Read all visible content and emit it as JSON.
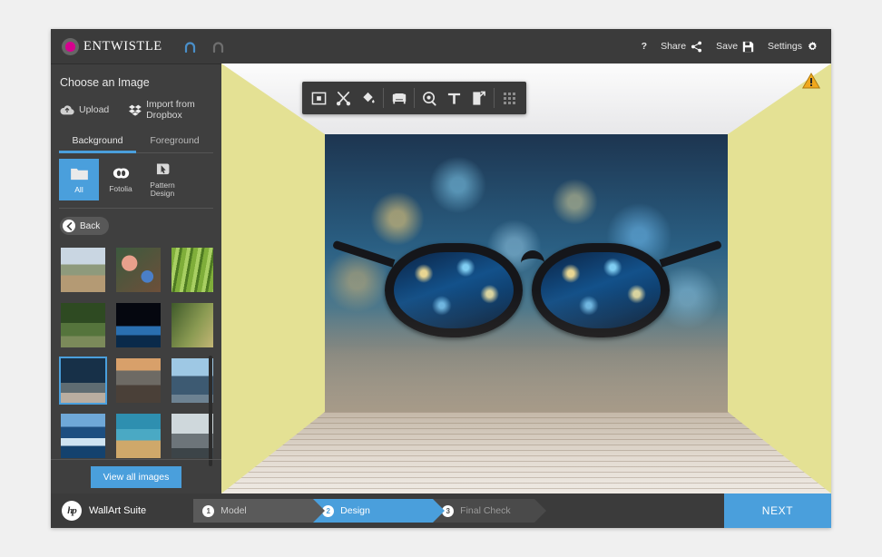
{
  "app": {
    "brand": "ENTWISTLE",
    "logo_color": "#d6008f",
    "accent_color": "#4a9fdc",
    "wall_color": "#e4e194"
  },
  "header": {
    "undo_label": "Undo",
    "redo_label": "Redo",
    "help_label": "?",
    "share_label": "Share",
    "save_label": "Save",
    "settings_label": "Settings"
  },
  "sidebar": {
    "title": "Choose an Image",
    "sources": [
      {
        "label": "Upload",
        "icon": "upload-icon"
      },
      {
        "label": "Import from Dropbox",
        "icon": "dropbox-icon"
      }
    ],
    "tabs": [
      {
        "label": "Background",
        "active": true
      },
      {
        "label": "Foreground",
        "active": false
      }
    ],
    "categories": [
      {
        "label": "All",
        "icon": "folder-icon",
        "active": true
      },
      {
        "label": "Fotolia",
        "icon": "fotolia-icon",
        "active": false
      },
      {
        "label": "Pattern Design",
        "icon": "cursor-icon",
        "active": false
      }
    ],
    "back_label": "Back",
    "view_all_label": "View all images",
    "thumbnails": [
      {
        "name": "cityscape-rooftops",
        "selected": false,
        "css": "linear-gradient(#c9d6e2 0 38%, #8e9a7c 38% 62%, #b49a74 62% 100%)"
      },
      {
        "name": "coral-reef-flowers",
        "selected": false,
        "css": "radial-gradient(circle at 30% 35%, #e8a08c 0 18%, transparent 19%), radial-gradient(circle at 70% 65%, #4a7fc8 0 14%, transparent 15%), linear-gradient(140deg,#3c5a3e,#6d4f3a)"
      },
      {
        "name": "bamboo-stalks",
        "selected": false,
        "css": "repeating-linear-gradient(100deg, #7fae3a 0 5px, #a8cf62 5px 9px, #4e7a22 9px 12px)"
      },
      {
        "name": "forest-path",
        "selected": false,
        "css": "linear-gradient(#2e4a22 0 45%, #55743c 45% 75%, #7b8a5a 75% 100%)"
      },
      {
        "name": "earth-from-space",
        "selected": false,
        "css": "linear-gradient(#05070f 0 52%, #2a6fb0 52% 72%, #0a2a4a 72% 100%)"
      },
      {
        "name": "green-tunnel-road",
        "selected": false,
        "css": "linear-gradient(120deg,#3f5a2a,#8a9a52 55%,#c8b878)"
      },
      {
        "name": "glasses-city-night",
        "selected": true,
        "css": "linear-gradient(#173048 0 55%, #5f6c72 55% 78%, #b9ada0 78% 100%)"
      },
      {
        "name": "rocky-coast-sunset",
        "selected": false,
        "css": "linear-gradient(#d8a06a 0 28%, #6d6a64 28% 60%, #4a4038 60% 100%)"
      },
      {
        "name": "skyscrapers-blue",
        "selected": false,
        "css": "linear-gradient(#9ec8e4 0 40%, #3d5a72 40% 82%, #6d8292 82% 100%)"
      },
      {
        "name": "iceberg-ocean",
        "selected": false,
        "css": "linear-gradient(#6fa8d8 0 30%, #1d4e80 30% 55%, #cfe4f2 55% 72%, #14426e 72% 100%)"
      },
      {
        "name": "sea-turtle-reef",
        "selected": false,
        "css": "linear-gradient(#2e8fb0 0 35%, #4aa9c4 35% 60%, #cfa86a 60% 100%)"
      },
      {
        "name": "viewing-binoculars",
        "selected": false,
        "css": "linear-gradient(#cfd8dc 0 45%, #6d757a 45% 78%, #3c4448 78% 100%)"
      }
    ]
  },
  "toolbar": {
    "tools": [
      {
        "name": "crop-tool",
        "icon": "crop-icon"
      },
      {
        "name": "cut-tool",
        "icon": "scissors-icon"
      },
      {
        "name": "fill-tool",
        "icon": "paint-bucket-icon"
      },
      {
        "name": "furniture-tool",
        "icon": "sofa-icon"
      },
      {
        "name": "zoom-tool",
        "icon": "magnifier-icon"
      },
      {
        "name": "text-tool",
        "icon": "text-t-icon"
      },
      {
        "name": "export-tool",
        "icon": "export-icon"
      },
      {
        "name": "more-tool",
        "icon": "grid-dots-icon"
      }
    ]
  },
  "canvas": {
    "warning_label": "!",
    "warning_icon": "warning-triangle-icon",
    "image_name": "glasses-city-night"
  },
  "footer": {
    "hp_logo": "hp",
    "suite_name": "WallArt Suite",
    "steps": [
      {
        "num": "1",
        "label": "Model",
        "state": "done"
      },
      {
        "num": "2",
        "label": "Design",
        "state": "active"
      },
      {
        "num": "3",
        "label": "Final Check",
        "state": "pending"
      }
    ],
    "next_label": "NEXT"
  }
}
